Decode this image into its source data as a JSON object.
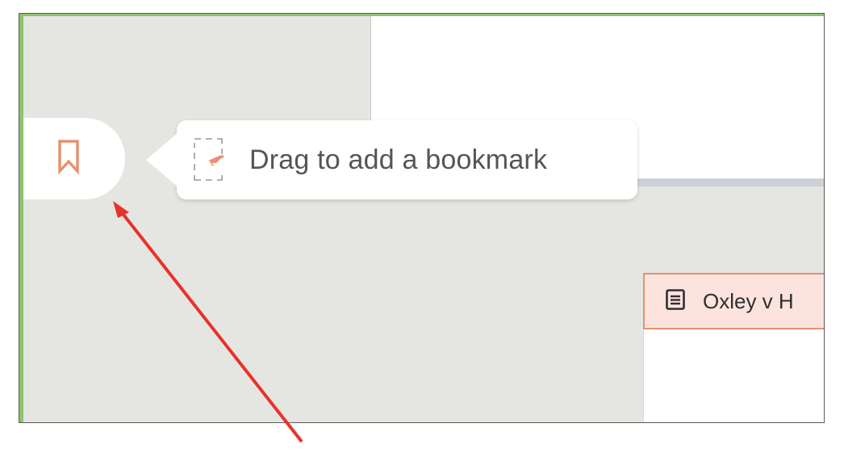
{
  "sidebar": {
    "bookmark_tab_icon": "bookmark-icon"
  },
  "tooltip": {
    "icon": "drag-arrow-icon",
    "text": "Drag to add a bookmark"
  },
  "document_tab": {
    "icon": "document-icon",
    "title": "Oxley v H"
  },
  "annotation": {
    "arrow_color": "#e8322a"
  },
  "colors": {
    "accent": "#e8906e",
    "green_border": "#8cc46a",
    "tab_bg": "#fce3de"
  }
}
